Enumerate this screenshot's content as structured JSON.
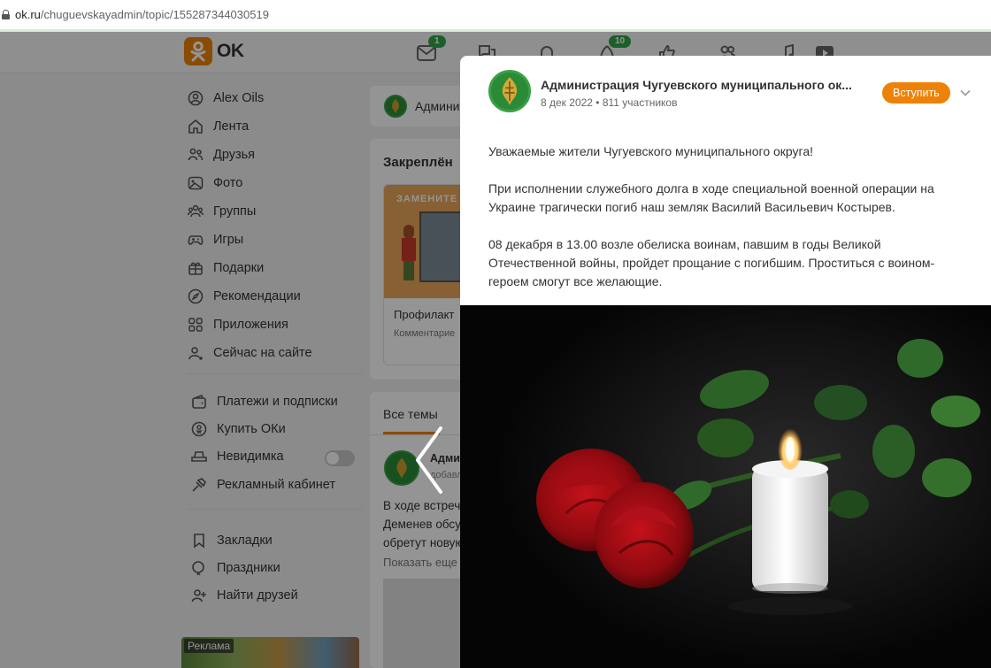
{
  "browser": {
    "url_host": "ok.ru",
    "url_path": "/chuguevskayadmin/topic/155287344030519"
  },
  "header": {
    "logo_text": "OK",
    "icons": [
      {
        "name": "messages-icon",
        "badge": "1"
      },
      {
        "name": "discussions-icon",
        "badge": ""
      },
      {
        "name": "notifications-icon",
        "badge": ""
      },
      {
        "name": "guests-icon",
        "badge": "10"
      },
      {
        "name": "events-icon",
        "badge": ""
      },
      {
        "name": "friends-icon",
        "badge": ""
      },
      {
        "name": "music-icon",
        "badge": ""
      },
      {
        "name": "video-icon",
        "badge": ""
      }
    ]
  },
  "sidebar": {
    "items": [
      {
        "label": "Alex Oils",
        "icon": "user-icon"
      },
      {
        "label": "Лента",
        "icon": "home-icon"
      },
      {
        "label": "Друзья",
        "icon": "friends-icon"
      },
      {
        "label": "Фото",
        "icon": "photo-icon"
      },
      {
        "label": "Группы",
        "icon": "groups-icon"
      },
      {
        "label": "Игры",
        "icon": "games-icon"
      },
      {
        "label": "Подарки",
        "icon": "gift-icon"
      },
      {
        "label": "Рекомендации",
        "icon": "compass-icon"
      },
      {
        "label": "Приложения",
        "icon": "apps-icon"
      },
      {
        "label": "Сейчас на сайте",
        "icon": "online-icon"
      }
    ],
    "items2": [
      {
        "label": "Платежи и подписки",
        "icon": "wallet-icon"
      },
      {
        "label": "Купить ОКи",
        "icon": "coin-icon"
      },
      {
        "label": "Невидимка",
        "icon": "invisible-icon"
      },
      {
        "label": "Рекламный кабинет",
        "icon": "ads-icon"
      }
    ],
    "items3": [
      {
        "label": "Закладки",
        "icon": "bookmark-icon"
      },
      {
        "label": "Праздники",
        "icon": "holiday-icon"
      },
      {
        "label": "Найти друзей",
        "icon": "add-friend-icon"
      }
    ],
    "ad_label": "Реклама"
  },
  "middle": {
    "group_name_partial": "Админи",
    "pinned_title": "Закреплён",
    "pinned_card_image_text": "ЗАМЕНИТЕ",
    "pinned_card_title": "Профилакт",
    "pinned_card_sub": "Комментарие",
    "tab_all": "Все темы",
    "post_author_partial": "Админ",
    "post_meta_partial": "добавл",
    "post_text_lines": [
      "В ходе встреч",
      "Деменев обсу",
      "обретут новую"
    ],
    "show_more": "Показать еще"
  },
  "modal": {
    "group_title": "Администрация Чугуевского муниципального ок...",
    "meta": "8 дек 2022 • 811 участников",
    "join_label": "Вступить",
    "paragraphs": [
      "Уважаемые жители Чугуевского муниципального округа!",
      "При исполнении служебного долга в ходе специальной военной операции на Украине трагически погиб наш земляк Василий Васильевич Костырев.",
      "08 декабря в 13.00 возле обелиска воинам, павшим  в годы Великой Отечественной войны, пройдет прощание с погибшим. Проститься с воином-героем смогут все желающие."
    ]
  },
  "colors": {
    "accent": "#ee8208",
    "badge_green": "#2fa545"
  }
}
